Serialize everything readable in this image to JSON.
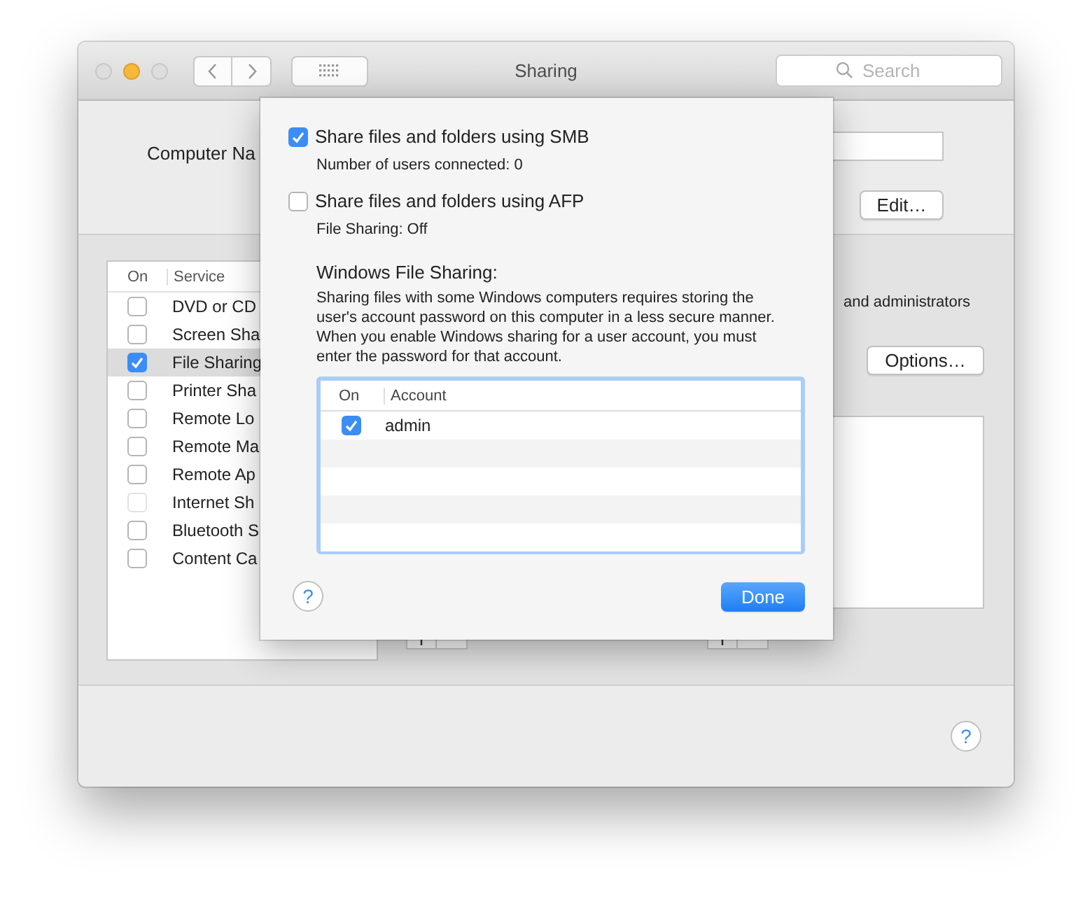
{
  "window": {
    "title": "Sharing"
  },
  "search": {
    "placeholder": "Search"
  },
  "computer_name": {
    "label": "Computer Na",
    "edit_button": "Edit…"
  },
  "services": {
    "columns": [
      "On",
      "Service"
    ],
    "rows": [
      {
        "name": "DVD or CD",
        "checked": false,
        "disabled": false,
        "selected": false
      },
      {
        "name": "Screen Sha",
        "checked": false,
        "disabled": false,
        "selected": false
      },
      {
        "name": "File Sharing",
        "checked": true,
        "disabled": false,
        "selected": true
      },
      {
        "name": "Printer Sha",
        "checked": false,
        "disabled": false,
        "selected": false
      },
      {
        "name": "Remote Lo",
        "checked": false,
        "disabled": false,
        "selected": false
      },
      {
        "name": "Remote Ma",
        "checked": false,
        "disabled": false,
        "selected": false
      },
      {
        "name": "Remote Ap",
        "checked": false,
        "disabled": false,
        "selected": false
      },
      {
        "name": "Internet Sh",
        "checked": false,
        "disabled": true,
        "selected": false
      },
      {
        "name": "Bluetooth S",
        "checked": false,
        "disabled": false,
        "selected": false
      },
      {
        "name": "Content Ca",
        "checked": false,
        "disabled": false,
        "selected": false
      }
    ]
  },
  "access_text": "and administrators",
  "options_button": "Options…",
  "help_button": "?",
  "sheet": {
    "options": [
      {
        "label": "Share files and folders using SMB",
        "checked": true,
        "status": "Number of users connected: 0"
      },
      {
        "label": "Share files and folders using AFP",
        "checked": false,
        "status": "File Sharing: Off"
      }
    ],
    "windows_heading": "Windows File Sharing:",
    "windows_text": "Sharing files with some Windows computers requires storing the user's account password on this computer in a less secure manner.  When you enable Windows sharing for a user account, you must enter the password for that account.",
    "accounts": {
      "columns": [
        "On",
        "Account"
      ],
      "rows": [
        {
          "name": "admin",
          "checked": true
        }
      ]
    },
    "help_button": "?",
    "done_button": "Done"
  }
}
